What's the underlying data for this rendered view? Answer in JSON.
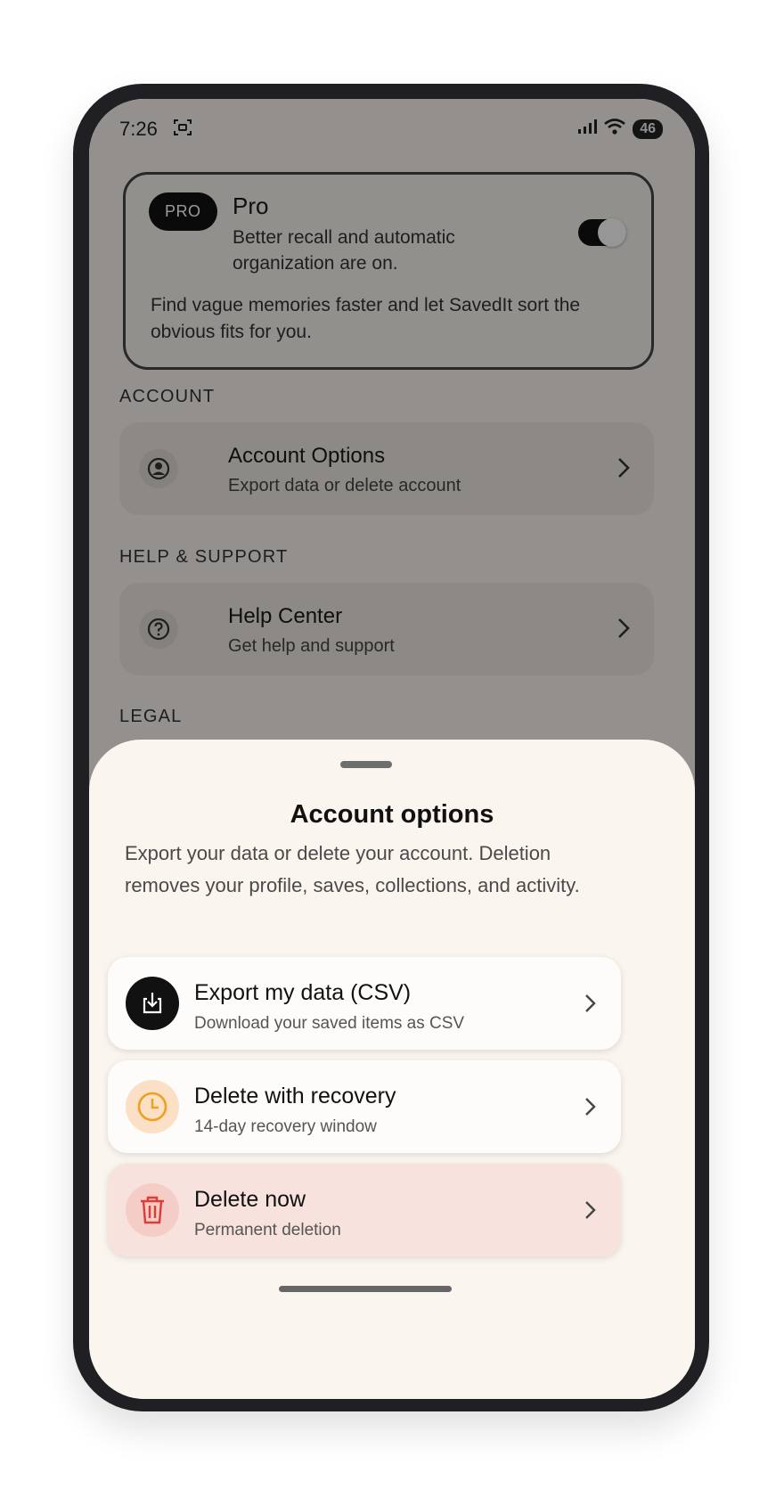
{
  "status_bar": {
    "time": "7:26",
    "battery": "46"
  },
  "pro_card": {
    "badge": "PRO",
    "title": "Pro",
    "subtitle": "Better recall and automatic organization are on.",
    "toggle_on": true,
    "description": "Find vague memories faster and let SavedIt sort the obvious fits for you."
  },
  "sections": {
    "account": {
      "label": "ACCOUNT",
      "row_title": "Account Options",
      "row_subtitle": "Export data or delete account"
    },
    "help": {
      "label": "HELP & SUPPORT",
      "row_title": "Help Center",
      "row_subtitle": "Get help and support"
    },
    "legal": {
      "label": "LEGAL"
    }
  },
  "sheet": {
    "title": "Account options",
    "description": "Export your data or delete your account. Deletion removes your profile, saves, collections, and activity.",
    "options": [
      {
        "title": "Export my data (CSV)",
        "subtitle": "Download your saved items as CSV",
        "icon": "download-icon",
        "color": "#111111"
      },
      {
        "title": "Delete with recovery",
        "subtitle": "14-day recovery window",
        "icon": "clock-icon",
        "color": "#f0a020"
      },
      {
        "title": "Delete now",
        "subtitle": "Permanent deletion",
        "icon": "trash-icon",
        "color": "#e23a35"
      }
    ]
  }
}
